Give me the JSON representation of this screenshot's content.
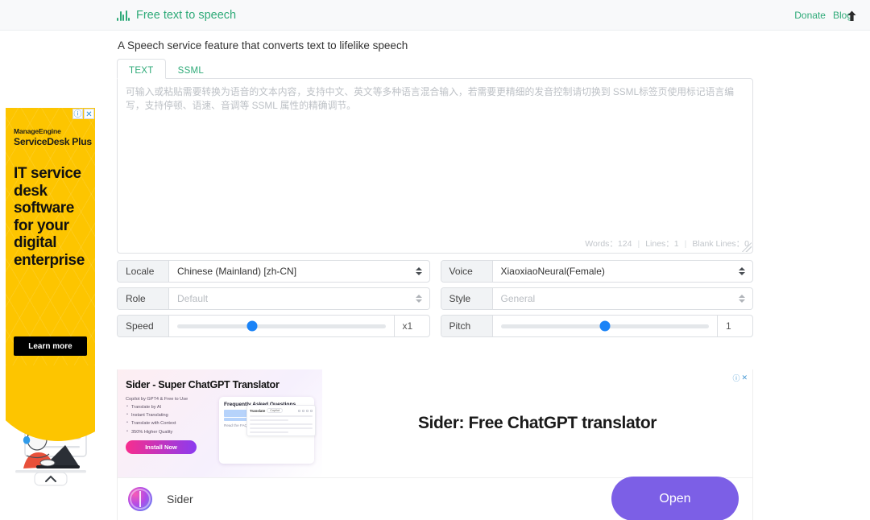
{
  "header": {
    "brand": "Free text to speech",
    "logo_icon": "audio-wave-icon",
    "accent": "#2eaa78",
    "links": [
      {
        "label": "Donate"
      },
      {
        "label": "Blog"
      }
    ]
  },
  "main": {
    "subtitle": "A Speech service feature that converts text to lifelike speech",
    "tabs": [
      {
        "label": "TEXT",
        "active": true
      },
      {
        "label": "SSML",
        "active": false
      }
    ],
    "editor": {
      "value": "可输入或粘贴需要转换为语音的文本内容，支持中文、英文等多种语言混合输入，若需要更精细的发音控制请切换到 SSML标签页使用标记语言编写，支持停顿、语速、音调等 SSML 属性的精确调节。",
      "words_label": "Words：124",
      "lines_label": "Lines：1",
      "blank_lines_label": "Blank Lines：0",
      "separator": "|"
    },
    "options": {
      "locale": {
        "label": "Locale",
        "value": "Chinese (Mainland) [zh-CN]",
        "disabled": false
      },
      "voice": {
        "label": "Voice",
        "value": "XiaoxiaoNeural(Female)",
        "disabled": false
      },
      "role": {
        "label": "Role",
        "value": "Default",
        "disabled": true
      },
      "style": {
        "label": "Style",
        "value": "General",
        "disabled": true
      },
      "speed": {
        "label": "Speed",
        "value": "x1",
        "percent": 36
      },
      "pitch": {
        "label": "Pitch",
        "value": "1",
        "percent": 50
      }
    }
  },
  "left_ad": {
    "brand": "ManageEngine",
    "product": "ServiceDesk Plus",
    "headline": "IT service desk software for your digital enterprise",
    "cta": "Learn more",
    "adchoices_info": "ⓘ",
    "adchoices_close": "✕",
    "bg_color": "#fdc500"
  },
  "sider_ad": {
    "creative_title": "Sider - Super ChatGPT Translator",
    "creative_subtitle": "Copilot by GPT4 & Free to Use",
    "bullets": [
      "Translate by AI",
      "Instant Translating",
      "Translate with Context",
      "350% Higher Quality"
    ],
    "install_label": "Install Now",
    "faq_title": "Frequently Asked Questions",
    "faq_link": "Read the FAQs >",
    "faq_mini_tag": "Translate",
    "faq_mini_pill": "Copilot",
    "headline": "Sider: Free ChatGPT translator",
    "adchoices_info": "ⓘ",
    "adchoices_close": "✕",
    "app_name": "Sider",
    "open_label": "Open",
    "open_color": "#7c5fe6"
  },
  "scroll_top": {
    "icon": "arrow-up-icon",
    "glyph": "⬆"
  }
}
